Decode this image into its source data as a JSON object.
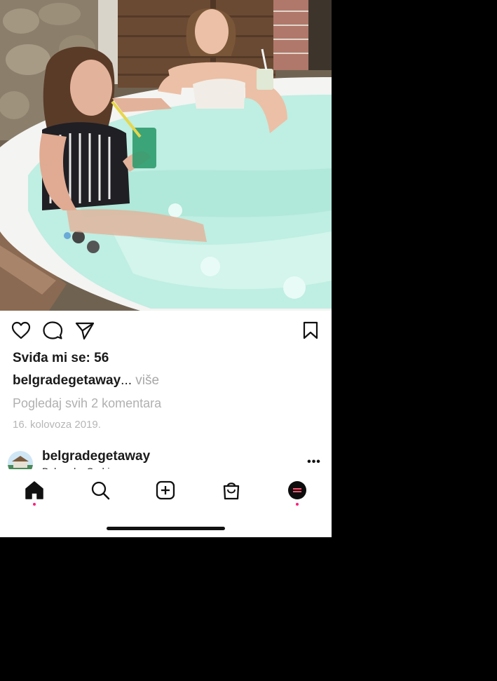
{
  "post": {
    "image_alt": "Two women relaxing in a hot tub",
    "likes_text": "Sviđa mi se: 56",
    "caption_user": "belgradegetaway",
    "caption_ellipsis": "...",
    "more_label": "više",
    "view_comments_label": "Pogledaj svih 2 komentara",
    "date": "16. kolovoza 2019."
  },
  "actions": {
    "like_icon": "heart-icon",
    "comment_icon": "comment-bubble-icon",
    "share_icon": "paper-plane-icon",
    "save_icon": "bookmark-icon"
  },
  "next_post": {
    "username": "belgradegetaway",
    "location": "Belgrade, Serbia",
    "more_icon": "•••"
  },
  "tab_bar": {
    "items": [
      "home-icon",
      "search-icon",
      "new-post-icon",
      "shop-bag-icon",
      "profile-avatar"
    ],
    "active": "home",
    "notification_color": "#ff1f7a"
  },
  "colors": {
    "text": "#1a1a1a",
    "muted": "#b0b0b0",
    "accent_dot": "#ff1f7a"
  }
}
